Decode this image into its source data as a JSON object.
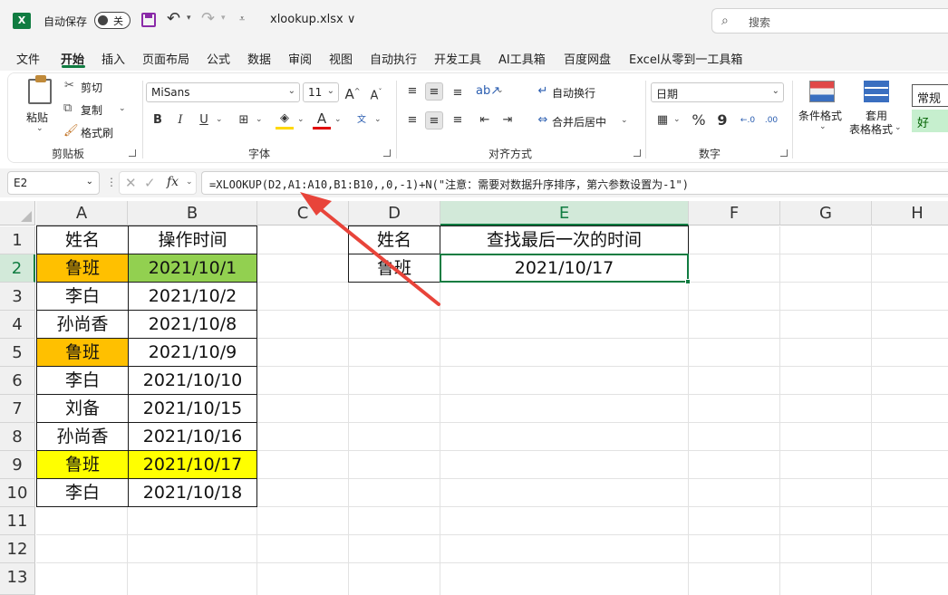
{
  "titlebar": {
    "app_logo": "X",
    "autosave_label": "自动保存",
    "autosave_state": "关",
    "file_name": "xlookup.xlsx ∨",
    "search_placeholder": "搜索"
  },
  "tabs": [
    "文件",
    "开始",
    "插入",
    "页面布局",
    "公式",
    "数据",
    "审阅",
    "视图",
    "自动执行",
    "开发工具",
    "AI工具箱",
    "百度网盘",
    "Excel从零到一工具箱"
  ],
  "active_tab": "开始",
  "ribbon": {
    "clipboard": {
      "paste": "粘贴",
      "cut": "剪切",
      "copy": "复制",
      "format_painter": "格式刷",
      "label": "剪贴板"
    },
    "font": {
      "font_name": "MiSans",
      "font_size": "11",
      "bold": "B",
      "italic": "I",
      "underline": "U",
      "grow": "A",
      "shrink": "A",
      "label": "字体"
    },
    "alignment": {
      "wrap_text": "自动换行",
      "merge_center": "合并后居中",
      "label": "对齐方式"
    },
    "number": {
      "format": "日期",
      "percent": "%",
      "comma": "9",
      "label": "数字"
    },
    "styles": {
      "conditional": "条件格式",
      "table_format_1": "套用",
      "table_format_2": "表格格式",
      "normal": "常规",
      "good": "好"
    }
  },
  "formula_bar": {
    "name_box": "E2",
    "formula": "=XLOOKUP(D2,A1:A10,B1:B10,,0,-1)+N(\"注意：需要对数据升序排序，第六参数设置为-1\")"
  },
  "columns": [
    "A",
    "B",
    "C",
    "D",
    "E",
    "F",
    "G",
    "H"
  ],
  "selected_column": "E",
  "selected_row": "2",
  "rows": [
    "1",
    "2",
    "3",
    "4",
    "5",
    "6",
    "7",
    "8",
    "9",
    "10",
    "11",
    "12",
    "13"
  ],
  "table1": {
    "headers": [
      "姓名",
      "操作时间"
    ],
    "rows": [
      [
        "鲁班",
        "2021/10/1"
      ],
      [
        "李白",
        "2021/10/2"
      ],
      [
        "孙尚香",
        "2021/10/8"
      ],
      [
        "鲁班",
        "2021/10/9"
      ],
      [
        "李白",
        "2021/10/10"
      ],
      [
        "刘备",
        "2021/10/15"
      ],
      [
        "孙尚香",
        "2021/10/16"
      ],
      [
        "鲁班",
        "2021/10/17"
      ],
      [
        "李白",
        "2021/10/18"
      ]
    ]
  },
  "table2": {
    "headers": [
      "姓名",
      "查找最后一次的时间"
    ],
    "row": [
      "鲁班",
      "2021/10/17"
    ]
  },
  "colors": {
    "orange_fill": "#ffc000",
    "green_fill": "#92d050",
    "yellow_fill": "#ffff00",
    "accent": "#107c41",
    "arrow": "#e8443a"
  }
}
